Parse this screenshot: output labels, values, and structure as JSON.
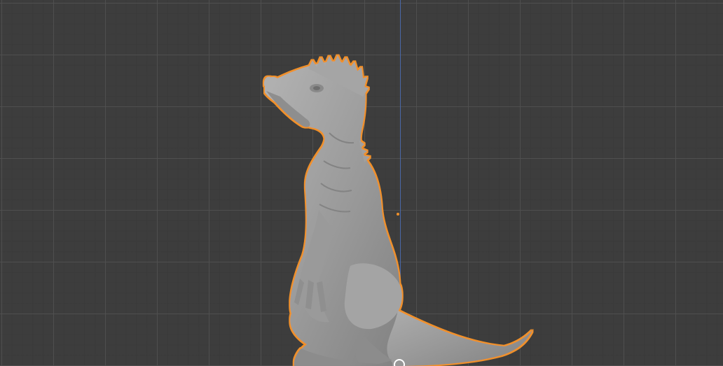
{
  "viewport": {
    "background_color": "#3d3d3d",
    "grid_minor_color": "#3a3a3a",
    "grid_major_color": "#505050",
    "axis_color": "#4a68a8",
    "selection_outline_color": "#f0902a",
    "mesh_color": "#9c9c9c",
    "selected_object": "dinosaur-sculpt",
    "origin_icon": "object-origin-dot",
    "cursor_icon": "3d-cursor-icon"
  }
}
